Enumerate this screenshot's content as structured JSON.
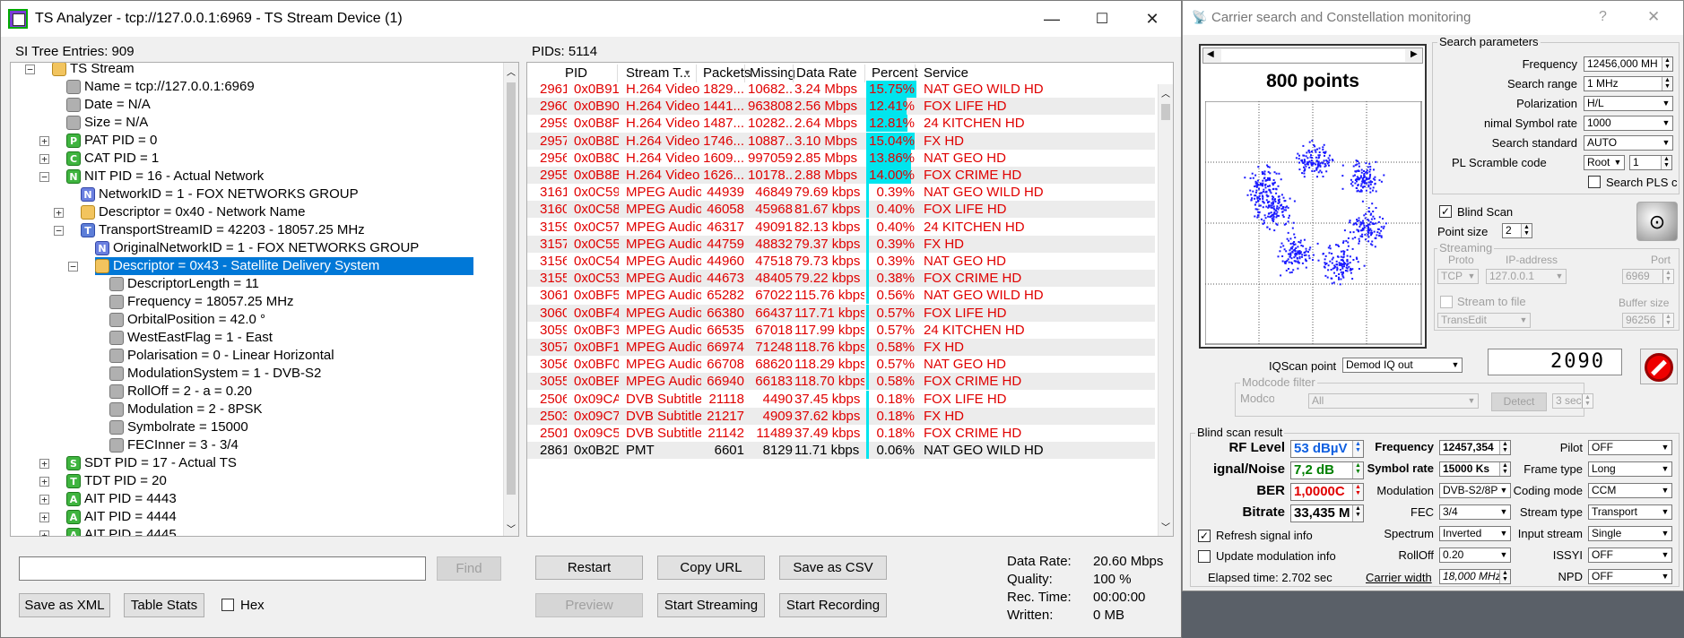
{
  "window": {
    "title": "TS Analyzer - tcp://127.0.0.1:6969 - TS Stream Device (1)",
    "min": "—",
    "max": "☐",
    "close": "✕"
  },
  "tree": {
    "header": "SI Tree Entries: 909",
    "items": [
      {
        "label": "TS Stream",
        "icon": "folder",
        "indent": 0,
        "exp": "−"
      },
      {
        "label": "Name = tcp://127.0.0.1:6969",
        "icon": "gray",
        "indent": 1,
        "exp": ""
      },
      {
        "label": "Date = N/A",
        "icon": "gray",
        "indent": 1,
        "exp": ""
      },
      {
        "label": "Size = N/A",
        "icon": "gray",
        "indent": 1,
        "exp": ""
      },
      {
        "label": "PAT PID = 0",
        "icon": "P",
        "indent": 1,
        "exp": "+"
      },
      {
        "label": "CAT PID = 1",
        "icon": "C",
        "indent": 1,
        "exp": "+"
      },
      {
        "label": "NIT PID = 16 - Actual Network",
        "icon": "N",
        "indent": 1,
        "exp": "−"
      },
      {
        "label": "NetworkID = 1 - FOX NETWORKS GROUP",
        "icon": "Nb",
        "indent": 2,
        "exp": ""
      },
      {
        "label": "Descriptor = 0x40 - Network Name",
        "icon": "folder",
        "indent": 2,
        "exp": "+"
      },
      {
        "label": "TransportStreamID = 42203 - 18057.25 MHz",
        "icon": "T",
        "indent": 2,
        "exp": "−"
      },
      {
        "label": "OriginalNetworkID = 1 - FOX NETWORKS GROUP",
        "icon": "Nb",
        "indent": 3,
        "exp": ""
      },
      {
        "label": "Descriptor = 0x43 - Satellite Delivery System",
        "icon": "folder",
        "indent": 3,
        "exp": "−",
        "selected": true
      },
      {
        "label": "DescriptorLength = 11",
        "icon": "gray",
        "indent": 4,
        "exp": ""
      },
      {
        "label": "Frequency = 18057.25 MHz",
        "icon": "gray",
        "indent": 4,
        "exp": ""
      },
      {
        "label": "OrbitalPosition = 42.0 °",
        "icon": "gray",
        "indent": 4,
        "exp": ""
      },
      {
        "label": "WestEastFlag = 1 - East",
        "icon": "gray",
        "indent": 4,
        "exp": ""
      },
      {
        "label": "Polarisation = 0 - Linear Horizontal",
        "icon": "gray",
        "indent": 4,
        "exp": ""
      },
      {
        "label": "ModulationSystem = 1 - DVB-S2",
        "icon": "gray",
        "indent": 4,
        "exp": ""
      },
      {
        "label": "RollOff = 2 - a = 0.20",
        "icon": "gray",
        "indent": 4,
        "exp": ""
      },
      {
        "label": "Modulation = 2 - 8PSK",
        "icon": "gray",
        "indent": 4,
        "exp": ""
      },
      {
        "label": "Symbolrate = 15000",
        "icon": "gray",
        "indent": 4,
        "exp": ""
      },
      {
        "label": "FECInner = 3 - 3/4",
        "icon": "gray",
        "indent": 4,
        "exp": ""
      },
      {
        "label": "SDT PID = 17 - Actual TS",
        "icon": "S",
        "indent": 1,
        "exp": "+"
      },
      {
        "label": "TDT PID = 20",
        "icon": "T2",
        "indent": 1,
        "exp": "+"
      },
      {
        "label": "AIT PID = 4443",
        "icon": "A",
        "indent": 1,
        "exp": "+"
      },
      {
        "label": "AIT PID = 4444",
        "icon": "A",
        "indent": 1,
        "exp": "+"
      },
      {
        "label": "AIT PID = 4445",
        "icon": "A",
        "indent": 1,
        "exp": "+"
      }
    ]
  },
  "pids": {
    "header": "PIDs: 5114",
    "columns": [
      "PID",
      "Stream T...",
      "Packets",
      "Missing",
      "Data Rate",
      "Percent",
      "Service"
    ],
    "rows": [
      [
        "2961",
        "0x0B91",
        "H.264 Video",
        "1829...",
        "10682...",
        "3.24 Mbps",
        "15.75%",
        "NAT GEO WILD HD",
        true,
        true
      ],
      [
        "2960",
        "0x0B90",
        "H.264 Video",
        "1441...",
        "963808",
        "2.56 Mbps",
        "12.41%",
        "FOX LIFE HD",
        true,
        true
      ],
      [
        "2959",
        "0x0B8F",
        "H.264 Video",
        "1487...",
        "10282...",
        "2.64 Mbps",
        "12.81%",
        "24 KITCHEN HD",
        true,
        true
      ],
      [
        "2957",
        "0x0B8D",
        "H.264 Video",
        "1746...",
        "10887...",
        "3.10 Mbps",
        "15.04%",
        "FX HD",
        true,
        true
      ],
      [
        "2956",
        "0x0B8C",
        "H.264 Video",
        "1609...",
        "997059",
        "2.85 Mbps",
        "13.86%",
        "NAT GEO HD",
        true,
        true
      ],
      [
        "2955",
        "0x0B8B",
        "H.264 Video",
        "1626...",
        "10178...",
        "2.88 Mbps",
        "14.00%",
        "FOX CRIME HD",
        true,
        true
      ],
      [
        "3161",
        "0x0C59",
        "MPEG Audio",
        "44939",
        "46849",
        "79.69 kbps",
        "0.39%",
        "NAT GEO WILD HD",
        true,
        false
      ],
      [
        "3160",
        "0x0C58",
        "MPEG Audio",
        "46058",
        "45968",
        "81.67 kbps",
        "0.40%",
        "FOX LIFE HD",
        true,
        false
      ],
      [
        "3159",
        "0x0C57",
        "MPEG Audio",
        "46317",
        "49091",
        "82.13 kbps",
        "0.40%",
        "24 KITCHEN HD",
        true,
        false
      ],
      [
        "3157",
        "0x0C55",
        "MPEG Audio",
        "44759",
        "48832",
        "79.37 kbps",
        "0.39%",
        "FX HD",
        true,
        false
      ],
      [
        "3156",
        "0x0C54",
        "MPEG Audio",
        "44960",
        "47518",
        "79.73 kbps",
        "0.39%",
        "NAT GEO HD",
        true,
        false
      ],
      [
        "3155",
        "0x0C53",
        "MPEG Audio",
        "44673",
        "48405",
        "79.22 kbps",
        "0.38%",
        "FOX CRIME HD",
        true,
        false
      ],
      [
        "3061",
        "0x0BF5",
        "MPEG Audio",
        "65282",
        "67022",
        "115.76 kbps",
        "0.56%",
        "NAT GEO WILD HD",
        true,
        false
      ],
      [
        "3060",
        "0x0BF4",
        "MPEG Audio",
        "66380",
        "66437",
        "117.71 kbps",
        "0.57%",
        "FOX LIFE HD",
        true,
        false
      ],
      [
        "3059",
        "0x0BF3",
        "MPEG Audio",
        "66535",
        "67018",
        "117.99 kbps",
        "0.57%",
        "24 KITCHEN HD",
        true,
        false
      ],
      [
        "3057",
        "0x0BF1",
        "MPEG Audio",
        "66974",
        "71248",
        "118.76 kbps",
        "0.58%",
        "FX HD",
        true,
        false
      ],
      [
        "3056",
        "0x0BF0",
        "MPEG Audio",
        "66708",
        "68620",
        "118.29 kbps",
        "0.57%",
        "NAT GEO HD",
        true,
        false
      ],
      [
        "3055",
        "0x0BEF",
        "MPEG Audio",
        "66940",
        "66183",
        "118.70 kbps",
        "0.58%",
        "FOX CRIME HD",
        true,
        false
      ],
      [
        "2506",
        "0x09CA",
        "DVB Subtitles",
        "21118",
        "4490",
        "37.45 kbps",
        "0.18%",
        "FOX LIFE HD",
        true,
        false
      ],
      [
        "2503",
        "0x09C7",
        "DVB Subtitles",
        "21217",
        "4909",
        "37.62 kbps",
        "0.18%",
        "FX HD",
        true,
        false
      ],
      [
        "2501",
        "0x09C5",
        "DVB Subtitles",
        "21142",
        "11489",
        "37.49 kbps",
        "0.18%",
        "FOX CRIME HD",
        true,
        false
      ],
      [
        "2861",
        "0x0B2D",
        "PMT",
        "6601",
        "8129",
        "11.71 kbps",
        "0.06%",
        "NAT GEO WILD HD",
        false,
        false
      ]
    ]
  },
  "bottom": {
    "search_value": "",
    "find": "Find",
    "restart": "Restart",
    "copy_url": "Copy URL",
    "save_csv": "Save as CSV",
    "save_xml": "Save as XML",
    "table_stats": "Table Stats",
    "hex": "Hex",
    "preview": "Preview",
    "start_streaming": "Start Streaming",
    "start_recording": "Start Recording",
    "stats": [
      [
        "Data Rate:",
        "20.60 Mbps"
      ],
      [
        "Quality:",
        "100 %"
      ],
      [
        "Rec. Time:",
        "00:00:00"
      ],
      [
        "Written:",
        "0 MB"
      ]
    ]
  },
  "carrier": {
    "title": "Carrier search and Constellation monitoring",
    "help": "?",
    "close": "✕",
    "const_title": "800 points",
    "search_params": "Search parameters",
    "params": [
      [
        "Frequency",
        "12456,000 MH"
      ],
      [
        "Search range",
        "1 MHz"
      ],
      [
        "Polarization",
        "H/L"
      ],
      [
        "nimal Symbol rate",
        "1000"
      ],
      [
        "Search standard",
        "AUTO"
      ]
    ],
    "pl_label": "PL Scramble code",
    "pl_val": "Root",
    "pl_num": "1",
    "search_pls": "Search PLS cc",
    "blind_scan": "Blind Scan",
    "point_size": "Point size",
    "point_size_val": "2",
    "streaming": "Streaming",
    "proto": "Proto",
    "ip": "IP-address",
    "port": "Port",
    "proto_val": "TCP",
    "ip_val": "127.0.0.1",
    "port_val": "6969",
    "stream_file": "Stream to file",
    "buffer": "Buffer size",
    "file_val": "TransEdit",
    "buffer_val": "96256",
    "counter": "2090",
    "iq_label": "IQScan point",
    "iq_val": "Demod IQ out",
    "modcode_filter": "Modcode filter",
    "modcode": "Modcod",
    "modcode_val": "All",
    "detect": "Detect",
    "sec": "3 sec",
    "bsr": "Blind scan result",
    "rf_label": "RF Level",
    "rf_val": "53 dBµV",
    "sn_label": "ignal/Noise",
    "sn_val": "7,2 dB",
    "ber_label": "BER",
    "ber_val": "1,0000C",
    "br_label": "Bitrate",
    "br_val": "33,435 M",
    "mid": [
      [
        "Frequency",
        "12457,354"
      ],
      [
        "Symbol rate",
        "15000 Ks"
      ],
      [
        "Modulation",
        "DVB-S2/8PS"
      ],
      [
        "FEC",
        "3/4"
      ],
      [
        "Spectrum",
        "Inverted"
      ],
      [
        "RollOff",
        "0.20"
      ]
    ],
    "carrier_width": "Carrier width",
    "carrier_width_val": "18,000 MHz",
    "right": [
      [
        "Pilot",
        "OFF"
      ],
      [
        "Frame type",
        "Long"
      ],
      [
        "Coding mode",
        "CCM"
      ],
      [
        "Stream type",
        "Transport"
      ],
      [
        "Input stream",
        "Single"
      ],
      [
        "ISSYI",
        "OFF"
      ],
      [
        "NPD",
        "OFF"
      ]
    ],
    "refresh": "Refresh signal info",
    "update": "Update modulation info",
    "elapsed": "Elapsed time: 2.702 sec",
    "colors": {
      "rf": "#1060e0",
      "sn": "#008000",
      "ber": "#e00000"
    }
  }
}
